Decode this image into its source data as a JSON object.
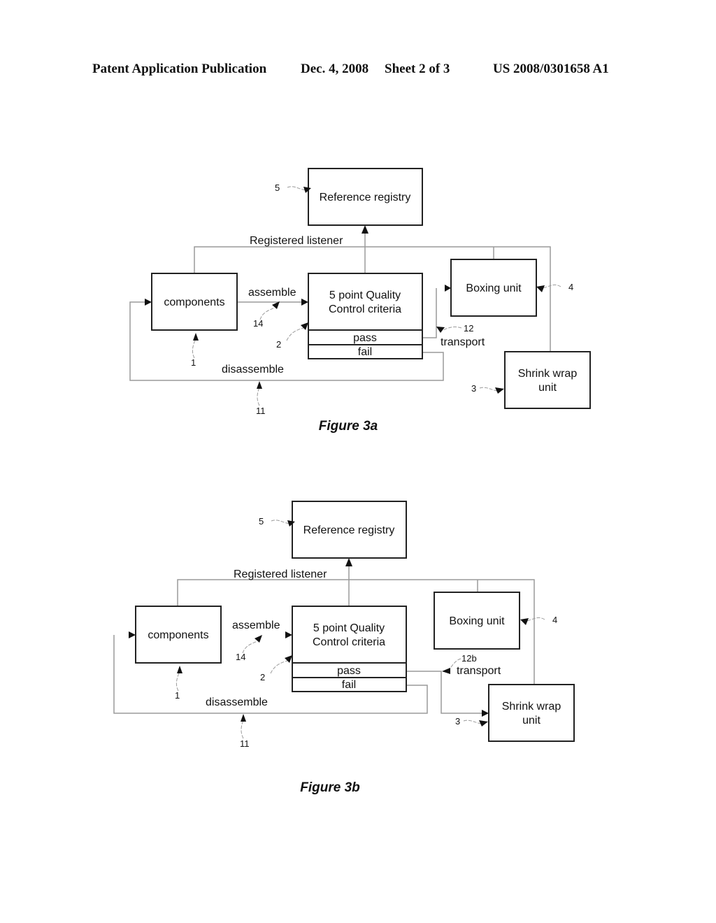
{
  "header": {
    "publication": "Patent Application Publication",
    "date": "Dec. 4, 2008",
    "sheet": "Sheet 2 of 3",
    "number": "US 2008/0301658 A1"
  },
  "figures": [
    {
      "caption": "Figure 3a",
      "boxes": {
        "registry": "Reference registry",
        "components": "components",
        "qc_line1": "5 point Quality",
        "qc_line2": "Control criteria",
        "pass": "pass",
        "fail": "fail",
        "boxing": "Boxing unit",
        "shrink_line1": "Shrink wrap",
        "shrink_line2": "unit"
      },
      "labels": {
        "listener": "Registered listener",
        "assemble": "assemble",
        "disassemble": "disassemble",
        "transport": "transport"
      },
      "refs": {
        "registry": "5",
        "components": "1",
        "qc": "2",
        "assemble": "14",
        "disassemble": "11",
        "transport": "12",
        "boxing": "4",
        "shrink": "3"
      }
    },
    {
      "caption": "Figure 3b",
      "boxes": {
        "registry": "Reference registry",
        "components": "components",
        "qc_line1": "5 point Quality",
        "qc_line2": "Control criteria",
        "pass": "pass",
        "fail": "fail",
        "boxing": "Boxing unit",
        "shrink_line1": "Shrink wrap",
        "shrink_line2": "unit"
      },
      "labels": {
        "listener": "Registered listener",
        "assemble": "assemble",
        "disassemble": "disassemble",
        "transport": "transport"
      },
      "refs": {
        "registry": "5",
        "components": "1",
        "qc": "2",
        "assemble": "14",
        "disassemble": "11",
        "transport": "12b",
        "boxing": "4",
        "shrink": "3"
      }
    }
  ]
}
